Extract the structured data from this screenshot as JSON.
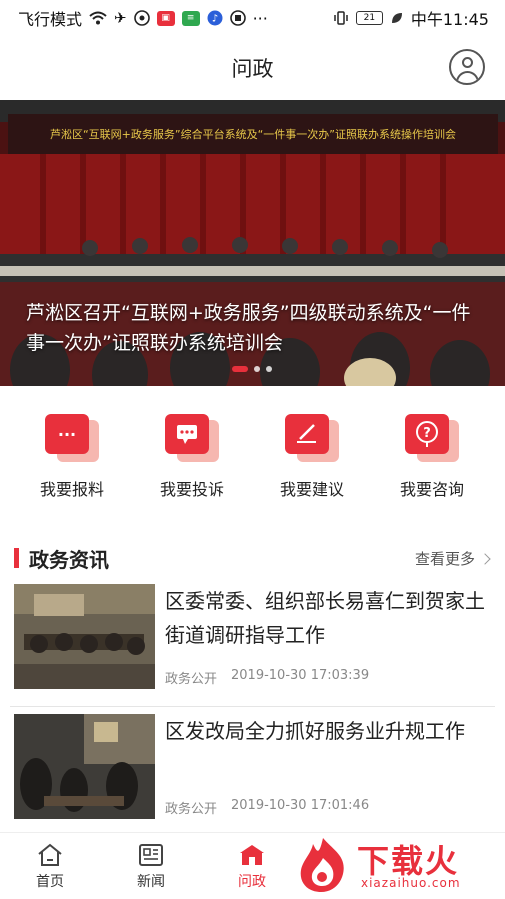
{
  "status_bar": {
    "left_text": "飞行模式",
    "icons": [
      "wifi-icon",
      "airplane-icon",
      "app-icon",
      "app-badge-icon",
      "chat-icon",
      "music-icon",
      "app-icon-2",
      "more-icon"
    ],
    "more": "···",
    "battery": "21",
    "time": "中午11:45"
  },
  "header": {
    "title": "问政",
    "user_icon": "user-icon"
  },
  "banner": {
    "caption": "芦淞区召开“互联网+政务服务”四级联动系统及“一件事一次办”证照联办系统培训会",
    "slide_count": 3,
    "active_slide": 1
  },
  "actions": [
    {
      "label": "我要报料",
      "icon": "report-icon"
    },
    {
      "label": "我要投诉",
      "icon": "complaint-icon"
    },
    {
      "label": "我要建议",
      "icon": "suggest-icon"
    },
    {
      "label": "我要咨询",
      "icon": "consult-icon"
    }
  ],
  "news_section": {
    "title": "政务资讯",
    "more_label": "查看更多",
    "items": [
      {
        "title": "区委常委、组织部长易喜仁到贺家土街道调研指导工作",
        "category": "政务公开",
        "time": "2019-10-30 17:03:39"
      },
      {
        "title": "区发改局全力抓好服务业升规工作",
        "category": "政务公开",
        "time": "2019-10-30 17:01:46"
      }
    ]
  },
  "bottom_nav": [
    {
      "label": "首页",
      "icon": "home-icon"
    },
    {
      "label": "新闻",
      "icon": "news-icon"
    },
    {
      "label": "问政",
      "icon": "govern-icon"
    }
  ],
  "watermark": {
    "text": "下载火",
    "sub": "xiazaihuo.com"
  },
  "colors": {
    "accent": "#e8303c",
    "accent_light": "#f6b7b0"
  }
}
